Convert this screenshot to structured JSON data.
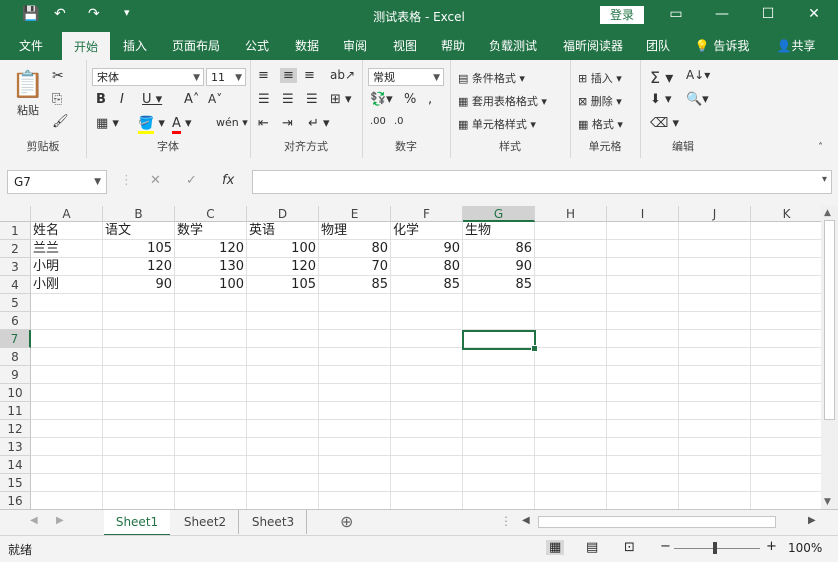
{
  "window": {
    "title": "测试表格  -  Excel",
    "login_label": "登录",
    "buttons": [
      "▭",
      "—",
      "☐",
      "✕"
    ]
  },
  "ribbon_tabs": [
    "文件",
    "开始",
    "插入",
    "页面布局",
    "公式",
    "数据",
    "审阅",
    "视图",
    "帮助",
    "负载测试",
    "福昕阅读器",
    "团队",
    "告诉我",
    "共享"
  ],
  "active_tab": "开始",
  "ribbon": {
    "clipboard": {
      "label": "剪贴板",
      "paste": "粘贴"
    },
    "font": {
      "label": "字体",
      "font_name": "宋体",
      "font_size": "11"
    },
    "alignment": {
      "label": "对齐方式"
    },
    "number": {
      "label": "数字",
      "format": "常规"
    },
    "styles": {
      "label": "样式",
      "conditional": "条件格式",
      "table": "套用表格格式",
      "cell": "单元格样式"
    },
    "cells": {
      "label": "单元格",
      "insert": "插入",
      "delete": "删除",
      "format": "格式"
    },
    "editing": {
      "label": "编辑"
    }
  },
  "formula_bar": {
    "name_box": "G7",
    "formula": ""
  },
  "columns": [
    "A",
    "B",
    "C",
    "D",
    "E",
    "F",
    "G",
    "H",
    "I",
    "J",
    "K"
  ],
  "rows": [
    "1",
    "2",
    "3",
    "4",
    "5",
    "6",
    "7",
    "8",
    "9",
    "10",
    "11",
    "12",
    "13",
    "14",
    "15",
    "16"
  ],
  "table": {
    "headers": [
      "姓名",
      "语文",
      "数学",
      "英语",
      "物理",
      "化学",
      "生物"
    ],
    "data": [
      [
        "兰兰",
        "105",
        "120",
        "100",
        "80",
        "90",
        "86"
      ],
      [
        "小明",
        "120",
        "130",
        "120",
        "70",
        "80",
        "90"
      ],
      [
        "小刚",
        "90",
        "100",
        "105",
        "85",
        "85",
        "85"
      ]
    ]
  },
  "sheets": [
    "Sheet1",
    "Sheet2",
    "Sheet3"
  ],
  "active_sheet": "Sheet1",
  "status": {
    "ready": "就绪",
    "zoom": "100%"
  }
}
